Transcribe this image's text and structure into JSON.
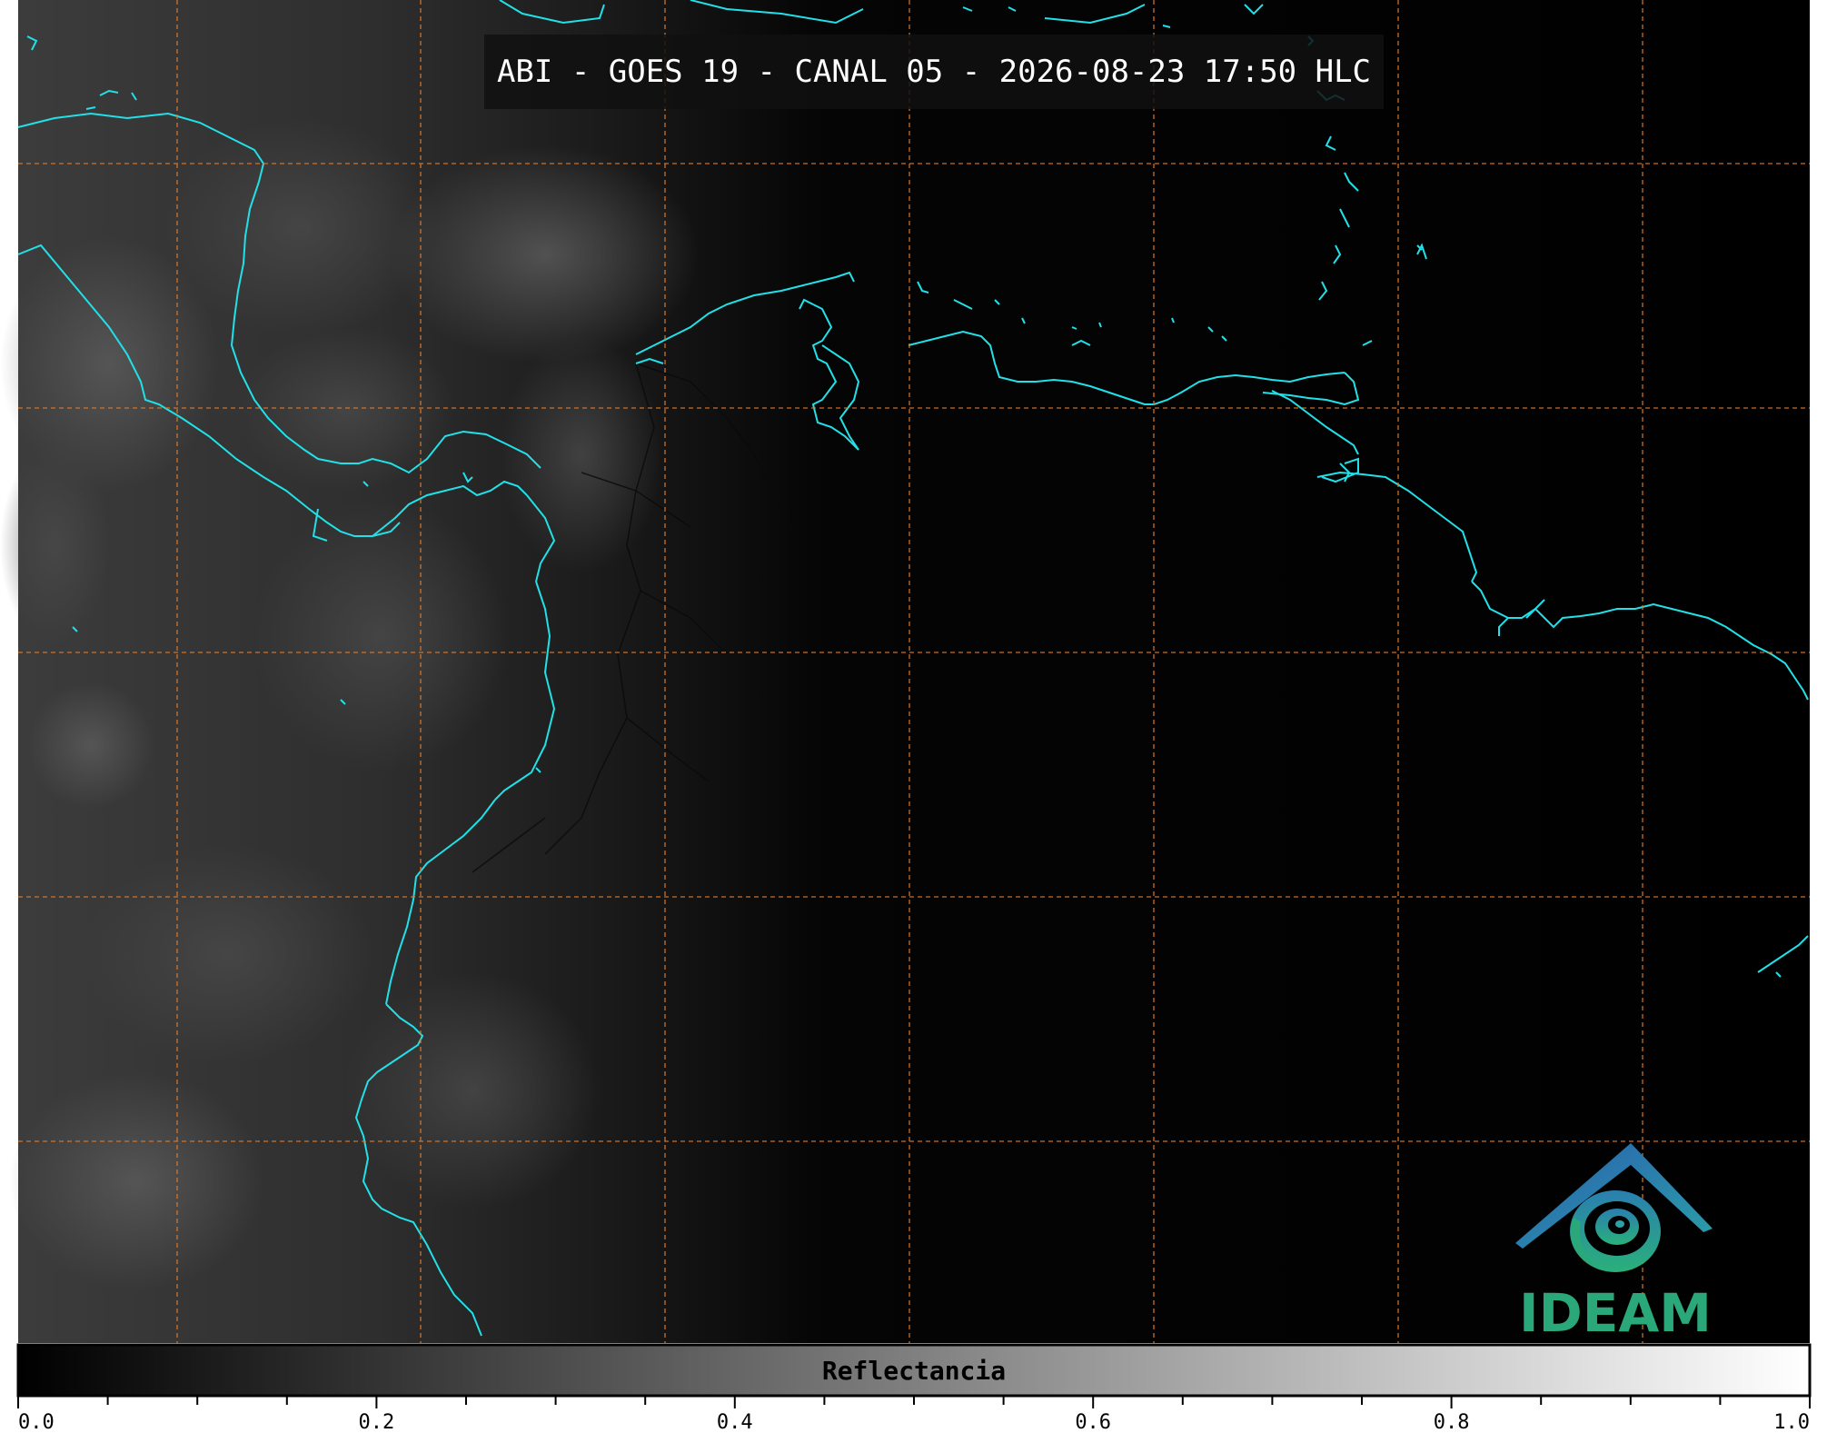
{
  "title": "ABI - GOES 19 - CANAL 05 - 2026-08-23 17:50 HLC",
  "colorbar": {
    "label": "Reflectancia",
    "min": 0.0,
    "max": 1.0,
    "major_ticks": [
      "0.0",
      "0.2",
      "0.4",
      "0.6",
      "0.8",
      "1.0"
    ],
    "gradient_from": "#000000",
    "gradient_to": "#ffffff"
  },
  "logo": {
    "text": "IDEAM",
    "color": "#2aa87a",
    "roof_color": "#2a6fb0"
  },
  "colors": {
    "coastline": "#22e0e8",
    "gridline": "#e07a2a",
    "borders": "#0a0a0a",
    "clouds": "#3a3a3a",
    "night": "#000000"
  }
}
